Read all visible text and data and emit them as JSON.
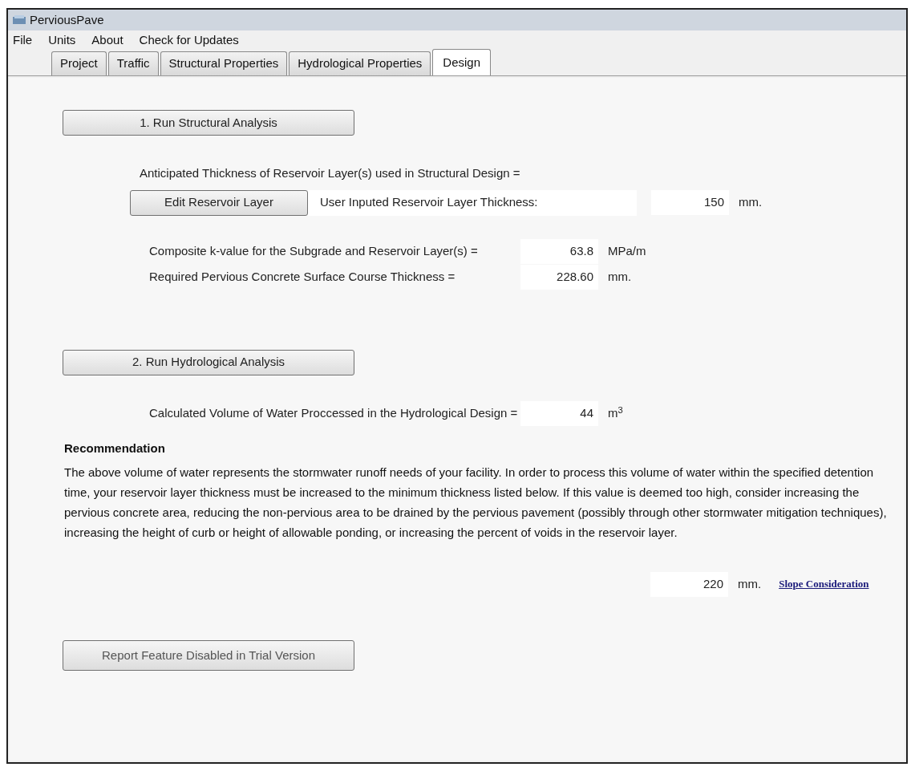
{
  "window": {
    "title": "PerviousPave"
  },
  "menu": [
    "File",
    "Units",
    "About",
    "Check for Updates"
  ],
  "tabs": [
    {
      "label": "Project",
      "selected": false
    },
    {
      "label": "Traffic",
      "selected": false
    },
    {
      "label": "Structural Properties",
      "selected": false
    },
    {
      "label": "Hydrological Properties",
      "selected": false
    },
    {
      "label": "Design",
      "selected": true
    }
  ],
  "structural_button": "1. Run Structural Analysis",
  "anticipated_label": "Anticipated Thickness of Reservoir Layer(s) used in Structural Design =",
  "edit_button": "Edit Reservoir Layer",
  "user_thickness": {
    "label": "User Inputed Reservoir Layer Thickness:",
    "value": "150",
    "unit": "mm."
  },
  "results": [
    {
      "label": "Composite k-value for the Subgrade and Reservoir Layer(s) =",
      "value": "63.8",
      "unit": "MPa/m"
    },
    {
      "label": "Required Pervious Concrete Surface Course Thickness =",
      "value": "228.60",
      "unit": "mm."
    }
  ],
  "hydrological_button": "2. Run Hydrological Analysis",
  "volume": {
    "label": "Calculated Volume of Water Proccessed in the Hydrological Design =",
    "value": "44",
    "unit": "m$^{3}$"
  },
  "recommendation": {
    "heading": "Recommendation",
    "text": "The above volume of water represents the stormwater runoff needs of your facility.  In order to process this volume of water within the specified detention time, your reservoir layer thickness must be increased to the minimum thickness listed below.  If this value is deemed too high, consider increasing the pervious concrete area, reducing the non-pervious area to be drained by the pervious pavement (possibly through other stormwater mitigation techniques), increasing the height of curb or height of allowable ponding, or increasing the percent of voids in the reservoir layer.",
    "value": "220",
    "unit": "mm.",
    "link": "Slope Consideration"
  },
  "report_button": {
    "label": "Report Feature Disabled in Trial Version",
    "disabled": true
  }
}
